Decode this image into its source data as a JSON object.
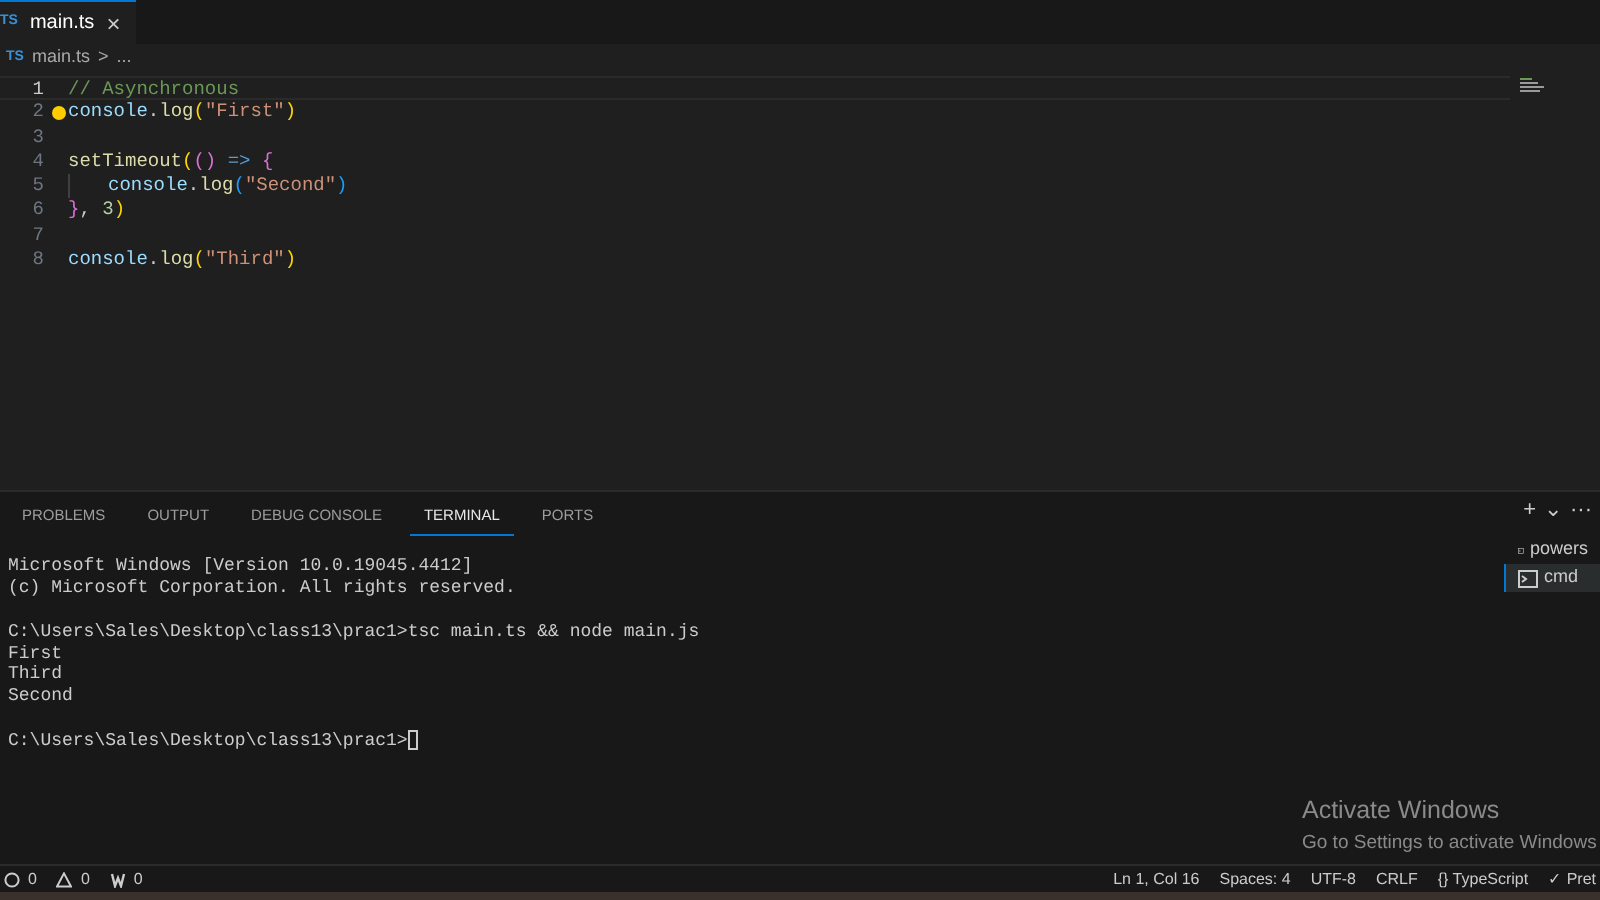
{
  "tabs": [
    {
      "icon": "TS",
      "label": "main.ts",
      "close": "×",
      "selected": true
    }
  ],
  "breadcrumb": {
    "icon": "TS",
    "file": "main.ts",
    "separator": ">",
    "rest": "..."
  },
  "editor": {
    "lines": [
      {
        "number": "1",
        "current": true,
        "tokens": [
          {
            "kind": "comment",
            "text": "// Asynchronous"
          }
        ]
      },
      {
        "number": "2",
        "current": false,
        "lightbulb": true,
        "tokens": [
          {
            "kind": "var",
            "text": "console"
          },
          {
            "kind": "plain",
            "text": "."
          },
          {
            "kind": "fn",
            "text": "log"
          },
          {
            "kind": "bracket",
            "text": "("
          },
          {
            "kind": "string",
            "text": "\"First\""
          },
          {
            "kind": "bracket",
            "text": ")"
          }
        ]
      },
      {
        "number": "3",
        "current": false
      },
      {
        "number": "4",
        "current": false,
        "tokens": [
          {
            "kind": "fn",
            "text": "setTimeout"
          },
          {
            "kind": "bracket",
            "text": "("
          },
          {
            "kind": "bracket2",
            "text": "()"
          },
          {
            "kind": "keyword",
            "text": " => "
          },
          {
            "kind": "bracket2",
            "text": "{"
          }
        ]
      },
      {
        "number": "5",
        "current": false,
        "indent": true,
        "tokens": [
          {
            "kind": "var",
            "text": "console"
          },
          {
            "kind": "plain",
            "text": "."
          },
          {
            "kind": "fn",
            "text": "log"
          },
          {
            "kind": "bracket3",
            "text": "("
          },
          {
            "kind": "string",
            "text": "\"Second\""
          },
          {
            "kind": "bracket3",
            "text": ")"
          }
        ]
      },
      {
        "number": "6",
        "current": false,
        "tokens": [
          {
            "kind": "bracket2",
            "text": "}"
          },
          {
            "kind": "plain",
            "text": ", "
          },
          {
            "kind": "number",
            "text": "3"
          },
          {
            "kind": "bracket",
            "text": ")"
          }
        ]
      },
      {
        "number": "7",
        "current": false
      },
      {
        "number": "8",
        "current": false,
        "tokens": [
          {
            "kind": "var",
            "text": "console"
          },
          {
            "kind": "plain",
            "text": "."
          },
          {
            "kind": "fn",
            "text": "log"
          },
          {
            "kind": "bracket",
            "text": "("
          },
          {
            "kind": "string",
            "text": "\"Third\""
          },
          {
            "kind": "bracket",
            "text": ")"
          }
        ]
      }
    ]
  },
  "panel": {
    "tabs": [
      {
        "label": "PROBLEMS",
        "selected": false
      },
      {
        "label": "OUTPUT",
        "selected": false
      },
      {
        "label": "DEBUG CONSOLE",
        "selected": false
      },
      {
        "label": "TERMINAL",
        "selected": true
      },
      {
        "label": "PORTS",
        "selected": false
      }
    ],
    "actions": {
      "add": "+",
      "dropdown": "⌄",
      "more": "···"
    },
    "terminal_lines": [
      {
        "text": "Microsoft Windows [Version 10.0.19045.4412]",
        "gap_before": false
      },
      {
        "text": "(c) Microsoft Corporation. All rights reserved.",
        "gap_before": false
      },
      {
        "text": "C:\\Users\\Sales\\Desktop\\class13\\prac1>tsc main.ts && node main.js",
        "gap_before": true
      },
      {
        "text": "First",
        "gap_before": false
      },
      {
        "text": "Third",
        "gap_before": false
      },
      {
        "text": "Second",
        "gap_before": false
      },
      {
        "text": "C:\\Users\\Sales\\Desktop\\class13\\prac1>",
        "gap_before": true
      }
    ],
    "terminals": [
      {
        "label": "powers",
        "selected": false
      },
      {
        "label": "cmd",
        "selected": true
      }
    ]
  },
  "activation_notice": {
    "title": "Activate Windows",
    "message": "Go to Settings to activate Windows"
  },
  "status_bar": {
    "left": [
      {
        "kind": "errors",
        "text": "0"
      },
      {
        "kind": "warnings",
        "text": "0"
      },
      {
        "kind": "ports",
        "text": "0"
      }
    ],
    "right": [
      "Ln 1, Col 16",
      "Spaces: 4",
      "UTF-8",
      "CRLF",
      "{} TypeScript",
      "✓ Pret"
    ]
  }
}
